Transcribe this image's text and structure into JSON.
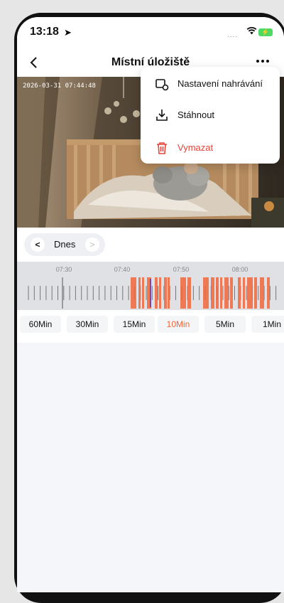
{
  "status_bar": {
    "time": "13:18",
    "location_icon": "location-arrow-icon",
    "signal": "....",
    "wifi_icon": "wifi-icon",
    "battery_icon": "battery-charging-icon"
  },
  "header": {
    "back_icon": "chevron-left-icon",
    "title": "Místní úložiště",
    "more_icon": "ellipsis-icon"
  },
  "video": {
    "timestamp": "2026-03-31  07:44:48"
  },
  "menu": {
    "items": [
      {
        "label": "Nastavení nahrávání",
        "icon": "recording-settings-icon"
      },
      {
        "label": "Stáhnout",
        "icon": "download-icon"
      },
      {
        "label": "Vymazat",
        "icon": "trash-icon",
        "color": "#e5443b"
      }
    ]
  },
  "date_selector": {
    "label": "Dnes"
  },
  "timeline": {
    "ticks": [
      "07:30",
      "07:40",
      "07:50",
      "08:00"
    ],
    "recording_color": "#f0663b",
    "cursor_color": "#5b4fcf"
  },
  "scale": {
    "options": [
      "60Min",
      "30Min",
      "15Min",
      "10Min",
      "5Min",
      "1Min"
    ],
    "selected": "10Min",
    "accent": "#f0663b"
  }
}
